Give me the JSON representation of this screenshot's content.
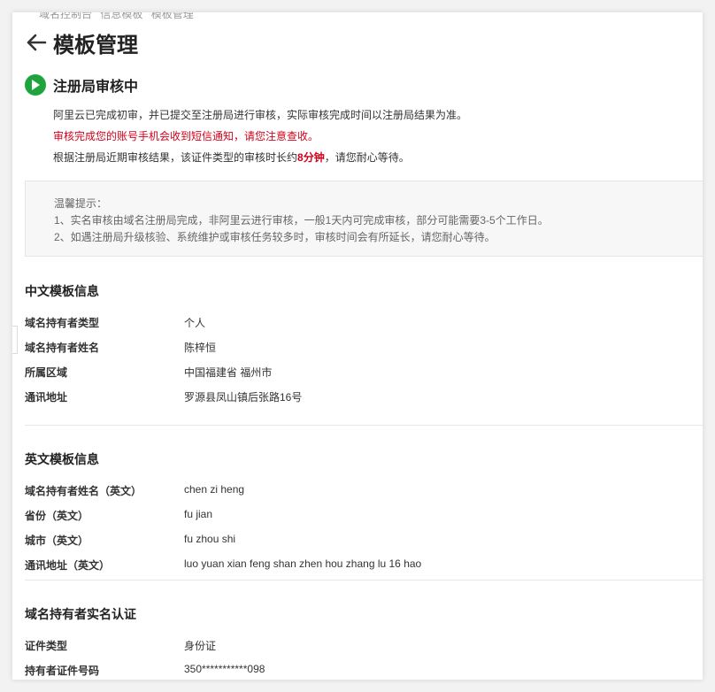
{
  "breadcrumb": [
    "域名控制台",
    "信息模板",
    "模板管理"
  ],
  "page_title": "模板管理",
  "status": {
    "title": "注册局审核中",
    "line1": "阿里云已完成初审，并已提交至注册局进行审核，实际审核完成时间以注册局结果为准。",
    "line2": "审核完成您的账号手机会收到短信通知，请您注意查收。",
    "line3_prefix": "根据注册局近期审核结果，该证件类型的审核时长约",
    "line3_highlight": "8分钟",
    "line3_suffix": "，请您耐心等待。"
  },
  "tips": {
    "heading": "温馨提示：",
    "item1": "1、实名审核由域名注册局完成，非阿里云进行审核，一般1天内可完成审核，部分可能需要3-5个工作日。",
    "item2": "2、如遇注册局升级核验、系统维护或审核任务较多时，审核时间会有所延长，请您耐心等待。"
  },
  "cn_section": {
    "title": "中文模板信息",
    "rows": [
      {
        "k": "域名持有者类型",
        "v": "个人"
      },
      {
        "k": "域名持有者姓名",
        "v": "陈梓恒"
      },
      {
        "k": "所属区域",
        "v": "中国福建省 福州市"
      },
      {
        "k": "通讯地址",
        "v": "罗源县凤山镇后张路16号"
      }
    ]
  },
  "en_section": {
    "title": "英文模板信息",
    "rows": [
      {
        "k": "域名持有者姓名（英文）",
        "v": "chen zi heng"
      },
      {
        "k": "省份（英文）",
        "v": "fu jian"
      },
      {
        "k": "城市（英文）",
        "v": "fu zhou shi"
      },
      {
        "k": "通讯地址（英文）",
        "v": "luo yuan xian feng shan zhen hou zhang lu 16 hao"
      }
    ]
  },
  "id_section": {
    "title": "域名持有者实名认证",
    "rows": [
      {
        "k": "证件类型",
        "v": "身份证"
      },
      {
        "k": "持有者证件号码",
        "v": "350***********098"
      }
    ]
  },
  "colors": {
    "accent_green": "#1fa33e",
    "warning_red": "#d0021b"
  }
}
